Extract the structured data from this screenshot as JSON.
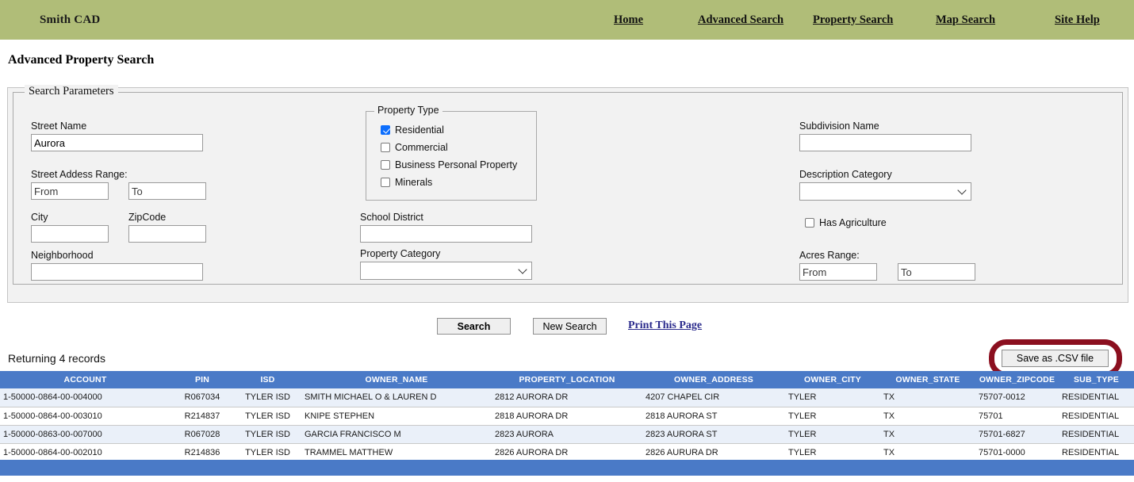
{
  "header": {
    "brand": "Smith CAD",
    "brand_bg": "#b0bd78",
    "nav": [
      {
        "label": "Home"
      },
      {
        "label": "Advanced Search"
      },
      {
        "label": "Property Search"
      },
      {
        "label": "Map Search"
      },
      {
        "label": "Site Help"
      }
    ]
  },
  "page": {
    "title": "Advanced Property Search"
  },
  "search_panel": {
    "legend": "Search Parameters",
    "street_name": {
      "label": "Street Name",
      "value": "Aurora",
      "placeholder": ""
    },
    "street_address_range": {
      "label": "Street Addess Range:",
      "from_placeholder": "From",
      "to_placeholder": "To",
      "from_value": "",
      "to_value": ""
    },
    "city": {
      "label": "City",
      "value": ""
    },
    "zipcode": {
      "label": "ZipCode",
      "value": ""
    },
    "neighborhood": {
      "label": "Neighborhood",
      "value": ""
    },
    "property_type": {
      "legend": "Property Type",
      "options": [
        {
          "label": "Residential",
          "checked": true
        },
        {
          "label": "Commercial",
          "checked": false
        },
        {
          "label": "Business Personal Property",
          "checked": false
        },
        {
          "label": "Minerals",
          "checked": false
        }
      ]
    },
    "school_district": {
      "label": "School District",
      "value": ""
    },
    "property_category": {
      "label": "Property Category",
      "selected": "",
      "options": [
        ""
      ]
    },
    "subdivision_name": {
      "label": "Subdivision Name",
      "value": ""
    },
    "description_category": {
      "label": "Description Category",
      "selected": "",
      "options": [
        ""
      ]
    },
    "has_agriculture": {
      "label": "Has Agriculture",
      "checked": false
    },
    "acres_range": {
      "label": "Acres Range:",
      "from_placeholder": "From",
      "to_placeholder": "To",
      "from_value": "",
      "to_value": ""
    }
  },
  "actions": {
    "search_label": "Search",
    "new_search_label": "New Search",
    "print_label": "Print This Page",
    "csv_label": "Save as .CSV file",
    "annotation_color": "#8b0f1f"
  },
  "results": {
    "records_text": "Returning 4 records",
    "header_bg": "#4a7ac7",
    "columns": [
      "ACCOUNT",
      "PIN",
      "ISD",
      "OWNER_NAME",
      "PROPERTY_LOCATION",
      "OWNER_ADDRESS",
      "OWNER_CITY",
      "OWNER_STATE",
      "OWNER_ZIPCODE",
      "SUB_TYPE"
    ],
    "rows": [
      [
        "1-50000-0864-00-004000",
        "R067034",
        "TYLER ISD",
        "SMITH MICHAEL O & LAUREN D",
        "2812 AURORA DR",
        "4207 CHAPEL CIR",
        "TYLER",
        "TX",
        "75707-0012",
        "RESIDENTIAL"
      ],
      [
        "1-50000-0864-00-003010",
        "R214837",
        "TYLER ISD",
        "KNIPE STEPHEN",
        "2818 AURORA DR",
        "2818 AURORA ST",
        "TYLER",
        "TX",
        "75701",
        "RESIDENTIAL"
      ],
      [
        "1-50000-0863-00-007000",
        "R067028",
        "TYLER ISD",
        "GARCIA FRANCISCO M",
        "2823 AURORA",
        "2823 AURORA ST",
        "TYLER",
        "TX",
        "75701-6827",
        "RESIDENTIAL"
      ],
      [
        "1-50000-0864-00-002010",
        "R214836",
        "TYLER ISD",
        "TRAMMEL MATTHEW",
        "2826 AURORA DR",
        "2826 AURURA DR",
        "TYLER",
        "TX",
        "75701-0000",
        "RESIDENTIAL"
      ]
    ]
  }
}
